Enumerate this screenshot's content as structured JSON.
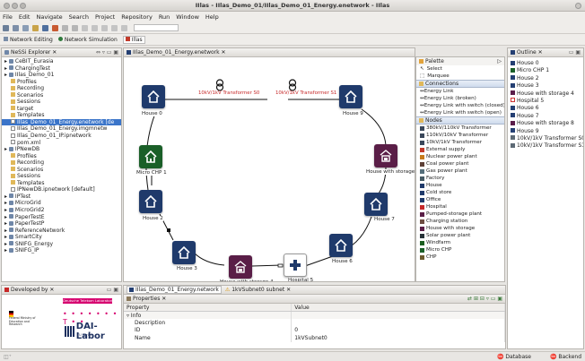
{
  "window": {
    "title": "IIlas - IIlas_Demo_01/IIlas_Demo_01_Energy.enetwork - IIlas"
  },
  "menu": [
    "File",
    "Edit",
    "Navigate",
    "Search",
    "Project",
    "Repository",
    "Run",
    "Window",
    "Help"
  ],
  "perspectives": [
    "Network Editing",
    "Network Simulation",
    "Illas"
  ],
  "explorer": {
    "tab": "NeSSi Explorer",
    "items": [
      {
        "depth": 0,
        "label": "CeBIT_Eurasia",
        "icon": "project-icon"
      },
      {
        "depth": 0,
        "label": "ChargingTest",
        "icon": "project-icon"
      },
      {
        "depth": 0,
        "label": "IIlas_Demo_01",
        "icon": "project-icon"
      },
      {
        "depth": 1,
        "label": "Profiles",
        "icon": "folder-icon"
      },
      {
        "depth": 1,
        "label": "Recording",
        "icon": "folder-icon"
      },
      {
        "depth": 1,
        "label": "Scenarios",
        "icon": "folder-icon"
      },
      {
        "depth": 1,
        "label": "Sessions",
        "icon": "folder-icon"
      },
      {
        "depth": 1,
        "label": "target",
        "icon": "folder-icon"
      },
      {
        "depth": 1,
        "label": "Templates",
        "icon": "folder-icon"
      },
      {
        "depth": 1,
        "label": "IIlas_Demo_01_Energy.enetwork [de",
        "icon": "file-icon",
        "selected": true
      },
      {
        "depth": 1,
        "label": "IIlas_Demo_01_Energy.imgmnetw",
        "icon": "file-icon"
      },
      {
        "depth": 1,
        "label": "IIlas_Demo_01_IP.ipnetwork",
        "icon": "file-icon"
      },
      {
        "depth": 1,
        "label": "pom.xml",
        "icon": "file-icon"
      },
      {
        "depth": 0,
        "label": "IPNewDB",
        "icon": "project-icon"
      },
      {
        "depth": 1,
        "label": "Profiles",
        "icon": "folder-icon"
      },
      {
        "depth": 1,
        "label": "Recording",
        "icon": "folder-icon"
      },
      {
        "depth": 1,
        "label": "Scenarios",
        "icon": "folder-icon"
      },
      {
        "depth": 1,
        "label": "Sessions",
        "icon": "folder-icon"
      },
      {
        "depth": 1,
        "label": "Templates",
        "icon": "folder-icon"
      },
      {
        "depth": 1,
        "label": "IPNewDB.ipnetwork [default]",
        "icon": "file-icon"
      },
      {
        "depth": 0,
        "label": "IPTest",
        "icon": "project-icon"
      },
      {
        "depth": 0,
        "label": "MicroGrid",
        "icon": "project-icon"
      },
      {
        "depth": 0,
        "label": "MicroGrid2",
        "icon": "project-icon"
      },
      {
        "depth": 0,
        "label": "PaperTestE",
        "icon": "project-icon"
      },
      {
        "depth": 0,
        "label": "PaperTestP",
        "icon": "project-icon"
      },
      {
        "depth": 0,
        "label": "ReferenceNetwork",
        "icon": "project-icon"
      },
      {
        "depth": 0,
        "label": "SmartCity",
        "icon": "project-icon"
      },
      {
        "depth": 0,
        "label": "SNIFG_Energy",
        "icon": "project-icon"
      },
      {
        "depth": 0,
        "label": "SNIFG_IP",
        "icon": "project-icon"
      }
    ]
  },
  "developed_by": {
    "tab": "Developed by",
    "logos": [
      "Deutsche Telekom Laboratories",
      "Federal Ministry of Education and Research",
      "DAI-Labor",
      "TU Berlin"
    ]
  },
  "editor": {
    "tab": "IIlas_Demo_01_Energy.enetwork",
    "nodes": [
      {
        "label": "House 0"
      },
      {
        "label": "10kV/1kV Transformer S0"
      },
      {
        "label": "10kV/1kV Transformer S1"
      },
      {
        "label": "House 9"
      },
      {
        "label": "House with storage 8"
      },
      {
        "label": "House 7"
      },
      {
        "label": "House 6"
      },
      {
        "label": "Hospital 5"
      },
      {
        "label": "House with storage 4"
      },
      {
        "label": "House 3"
      },
      {
        "label": "House 2"
      },
      {
        "label": "Micro CHP 1"
      }
    ]
  },
  "palette": {
    "title": "Palette",
    "tools": [
      "Select",
      "Marquee"
    ],
    "connections_header": "Connections",
    "connections": [
      "Energy Link",
      "Energy Link (broken)",
      "Energy Link with switch (closed)",
      "Energy Link with switch (open)"
    ],
    "nodes_header": "Nodes",
    "nodes": [
      "380kV/110kV Transformer",
      "110kV/10kV Transformer",
      "10kV/1kV Transformer",
      "External supply",
      "Nuclear power plant",
      "Coal power plant",
      "Gas power plant",
      "Factory",
      "House",
      "Cold store",
      "Office",
      "Hospital",
      "Pumped-storage plant",
      "Charging station",
      "House with storage",
      "Solar power plant",
      "Windfarm",
      "Micro CHP",
      "CHP"
    ]
  },
  "outline": {
    "tab": "Outline",
    "items": [
      "House 0",
      "Micro CHP 1",
      "House 2",
      "House 3",
      "House with storage 4",
      "Hospital 5",
      "House 6",
      "House 7",
      "House with storage 8",
      "House 9",
      "10kV/1kV Transformer S0",
      "10kV/1kV Transformer S1"
    ]
  },
  "bottom_tabs": [
    "IIlas_Demo_01_Energy.network",
    "1kVSubnet0 subnet"
  ],
  "properties": {
    "tab": "Properties",
    "columns": [
      "Property",
      "Value"
    ],
    "rows": [
      {
        "property": "Info",
        "value": ""
      },
      {
        "property": "Description",
        "value": ""
      },
      {
        "property": "ID",
        "value": "0"
      },
      {
        "property": "Name",
        "value": "1kVSubnet0"
      }
    ]
  },
  "status": {
    "database": "Database",
    "backend": "Backend"
  },
  "colors": {
    "house": "#1f3a6b",
    "storage": "#5a1e47",
    "chp": "#1a5f28",
    "hospital": "#ffffff",
    "link": "#111111",
    "transformer_label": "#c62828"
  }
}
